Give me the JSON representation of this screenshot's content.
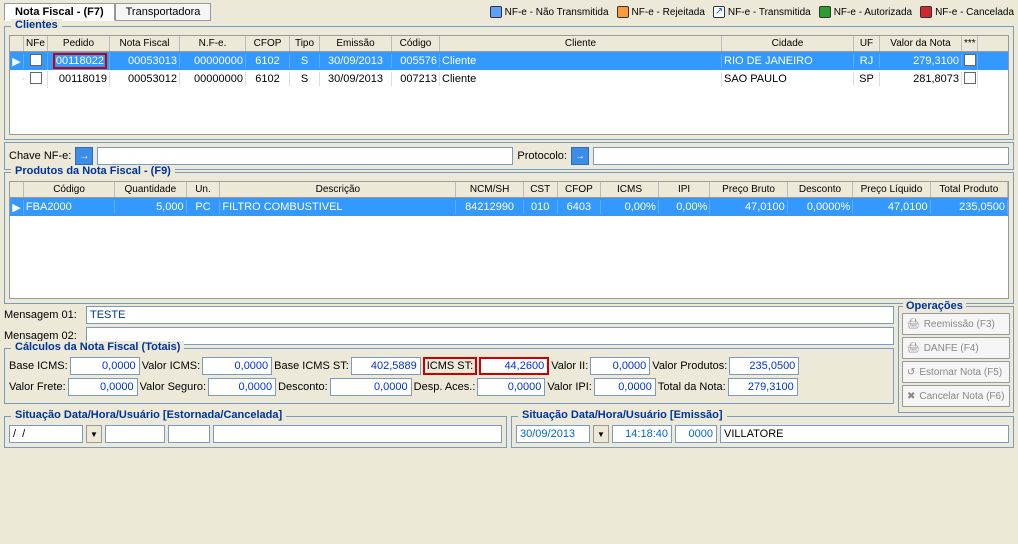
{
  "tabs": {
    "nota_fiscal": "Nota Fiscal - (F7)",
    "transportadora": "Transportadora"
  },
  "legend": {
    "nao_transmitida": {
      "label": "NF-e - Não Transmitida",
      "color": "#5aa0ff"
    },
    "rejeitada": {
      "label": "NF-e - Rejeitada",
      "color": "#ff9a3c"
    },
    "transmitida": {
      "label": "NF-e - Transmitida",
      "color": "#ffffff"
    },
    "autorizada": {
      "label": "NF-e - Autorizada",
      "color": "#2e9e2e"
    },
    "cancelada": {
      "label": "NF-e - Cancelada",
      "color": "#d22828"
    }
  },
  "clientes": {
    "title": "Clientes",
    "headers": {
      "nfe": "NFe",
      "pedido": "Pedido",
      "nota_fiscal": "Nota Fiscal",
      "nfe2": "N.F-e.",
      "cfop": "CFOP",
      "tipo": "Tipo",
      "emissao": "Emissão",
      "codigo": "Código",
      "cliente": "Cliente",
      "cidade": "Cidade",
      "uf": "UF",
      "valor": "Valor da Nota",
      "ast": "***"
    },
    "rows": [
      {
        "pedido": "00118022",
        "nota": "00053013",
        "nfe": "00000000",
        "cfop": "6102",
        "tipo": "S",
        "emissao": "30/09/2013",
        "codigo": "005576",
        "cliente": "Cliente",
        "cidade": "RIO DE JANEIRO",
        "uf": "RJ",
        "valor": "279,3100",
        "sel": true
      },
      {
        "pedido": "00118019",
        "nota": "00053012",
        "nfe": "00000000",
        "cfop": "6102",
        "tipo": "S",
        "emissao": "30/09/2013",
        "codigo": "007213",
        "cliente": "Cliente",
        "cidade": "SAO PAULO",
        "uf": "SP",
        "valor": "281,8073",
        "sel": false
      }
    ]
  },
  "chave": {
    "label": "Chave NF-e:",
    "protocolo": "Protocolo:"
  },
  "produtos": {
    "title": "Produtos da Nota  Fiscal - (F9)",
    "headers": {
      "codigo": "Código",
      "qtd": "Quantidade",
      "un": "Un.",
      "desc": "Descrição",
      "ncm": "NCM/SH",
      "cst": "CST",
      "cfop": "CFOP",
      "icms": "ICMS",
      "ipi": "IPI",
      "pb": "Preço Bruto",
      "desc2": "Desconto",
      "pl": "Preço Líquido",
      "tot": "Total Produto"
    },
    "rows": [
      {
        "codigo": "FBA2000",
        "qtd": "5,000",
        "un": "PC",
        "desc": "FILTRO COMBUSTIVEL",
        "ncm": "84212990",
        "cst": "010",
        "cfop": "6403",
        "icms": "0,00%",
        "ipi": "0,00%",
        "pb": "47,0100",
        "desc2": "0,0000%",
        "pl": "47,0100",
        "tot": "235,0500"
      }
    ]
  },
  "mensagens": {
    "label1": "Mensagem 01:",
    "value1": "TESTE",
    "label2": "Mensagem 02:",
    "value2": ""
  },
  "calculos": {
    "title": "Cálculos da Nota Fiscal (Totais)",
    "base_icms": {
      "label": "Base ICMS:",
      "value": "0,0000"
    },
    "valor_icms": {
      "label": "Valor ICMS:",
      "value": "0,0000"
    },
    "base_icms_st": {
      "label": "Base ICMS ST:",
      "value": "402,5889"
    },
    "icms_st": {
      "label": "ICMS ST:",
      "value": "44,2600"
    },
    "valor_ii": {
      "label": "Valor II:",
      "value": "0,0000"
    },
    "valor_produtos": {
      "label": "Valor Produtos:",
      "value": "235,0500"
    },
    "valor_frete": {
      "label": "Valor Frete:",
      "value": "0,0000"
    },
    "valor_seguro": {
      "label": "Valor Seguro:",
      "value": "0,0000"
    },
    "desconto": {
      "label": "Desconto:",
      "value": "0,0000"
    },
    "desp_aces": {
      "label": "Desp. Aces.:",
      "value": "0,0000"
    },
    "valor_ipi": {
      "label": "Valor IPI:",
      "value": "0,0000"
    },
    "total_nota": {
      "label": "Total da Nota:",
      "value": "279,3100"
    }
  },
  "operacoes": {
    "title": "Operações",
    "reemissao": "Reemissão (F3)",
    "danfe": "DANFE (F4)",
    "estornar": "Estornar Nota (F5)",
    "cancelar": "Cancelar Nota (F6)"
  },
  "situacao": {
    "estornada": {
      "title": "Situação  Data/Hora/Usuário [Estornada/Cancelada]",
      "data": "/  /",
      "hora": "",
      "id": "",
      "user": ""
    },
    "emissao": {
      "title": "Situação  Data/Hora/Usuário [Emissão]",
      "data": "30/09/2013",
      "hora": "14:18:40",
      "id": "0000",
      "user": "VILLATORE"
    }
  }
}
